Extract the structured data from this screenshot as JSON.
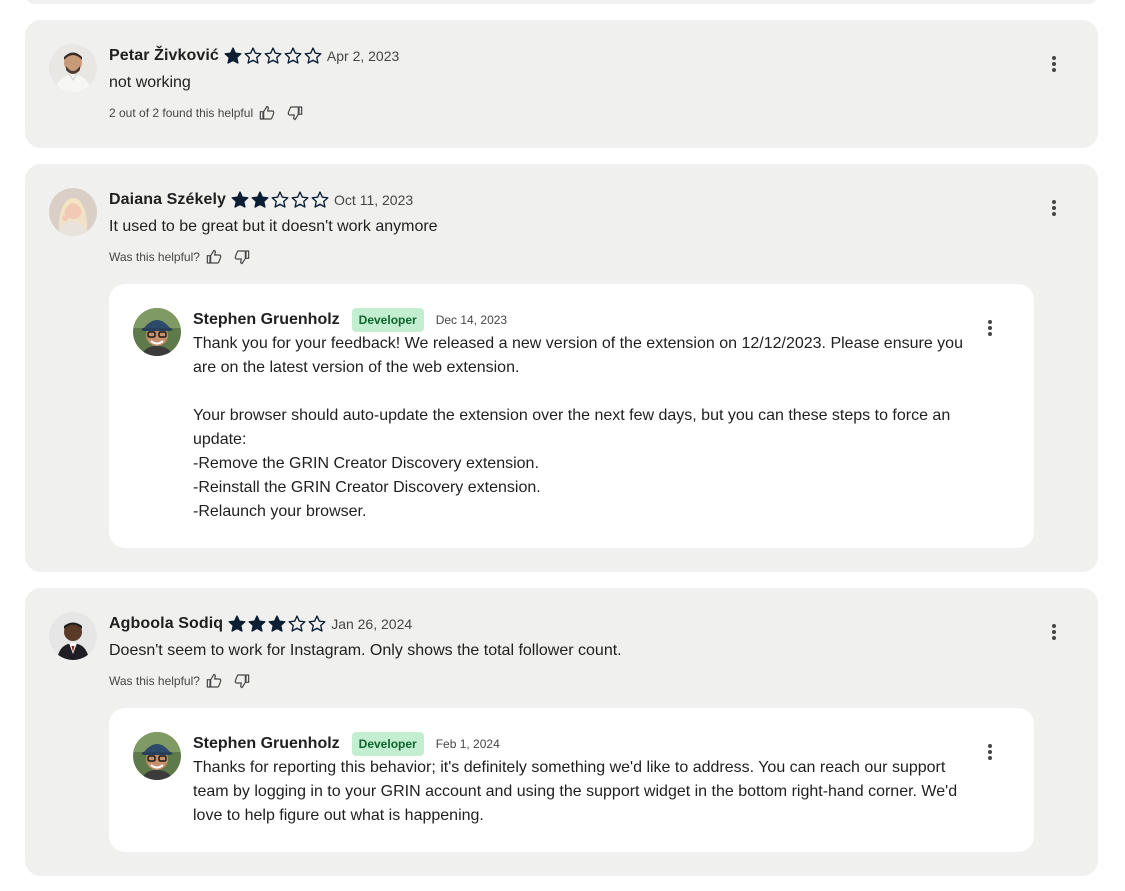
{
  "colors": {
    "card_background": "#f0f0ef",
    "reply_background": "#ffffff",
    "star_color": "#0b1e33",
    "badge_background": "#c4eed0",
    "badge_text": "#0d652d"
  },
  "icons": {
    "star_filled": "star-filled-icon",
    "star_empty": "star-outline-icon",
    "thumbs_up": "thumbs-up-icon",
    "thumbs_down": "thumbs-down-icon",
    "more": "more-vert-icon"
  },
  "reviews": [
    {
      "author": "Petar Živković",
      "rating": 1,
      "max_rating": 5,
      "date": "Apr 2, 2023",
      "text": "not working",
      "helpful_text": "2 out of 2 found this helpful"
    },
    {
      "author": "Daiana Székely",
      "rating": 2,
      "max_rating": 5,
      "date": "Oct 11, 2023",
      "text": "It used to be great but it doesn't work anymore",
      "helpful_text": "Was this helpful?",
      "reply": {
        "author": "Stephen Gruenholz",
        "badge": "Developer",
        "date": "Dec 14, 2023",
        "lines": [
          "Thank you for your feedback! We released a new version of the extension on 12/12/2023. Please ensure you are on the latest version of the web extension.",
          "",
          "Your browser should auto-update the extension over the next few days, but you can these steps to force an update:",
          "-Remove the GRIN Creator Discovery extension.",
          "-Reinstall the GRIN Creator Discovery extension.",
          "-Relaunch your browser."
        ]
      }
    },
    {
      "author": "Agboola Sodiq",
      "rating": 3,
      "max_rating": 5,
      "date": "Jan 26, 2024",
      "text": "Doesn't seem to work for Instagram. Only shows the total follower count.",
      "helpful_text": "Was this helpful?",
      "reply": {
        "author": "Stephen Gruenholz",
        "badge": "Developer",
        "date": "Feb 1, 2024",
        "lines": [
          "Thanks for reporting this behavior; it's definitely something we'd like to address. You can reach our support team by logging in to your GRIN account and using the support widget in the bottom right-hand corner. We'd love to help figure out what is happening."
        ]
      }
    }
  ]
}
